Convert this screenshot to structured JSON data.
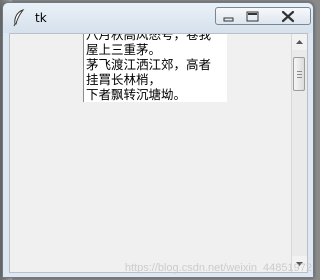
{
  "window": {
    "title": "tk",
    "icons": {
      "app": "feather-icon",
      "minimize": "minimize-icon",
      "maximize": "maximize-icon",
      "close": "close-icon"
    }
  },
  "text_widget": {
    "lines": [
      "八月秋高风怒号，卷我",
      "屋上三重茅。",
      "茅飞渡江洒江郊，高者",
      "挂罥长林梢，",
      "下者飘转沉塘坳。"
    ]
  },
  "watermark": "https://blog.csdn.net/weixin_44851972",
  "colors": {
    "client_background": "#f0f0f0",
    "text_background": "#ffffff",
    "titlebar": "#dfe7f0"
  }
}
